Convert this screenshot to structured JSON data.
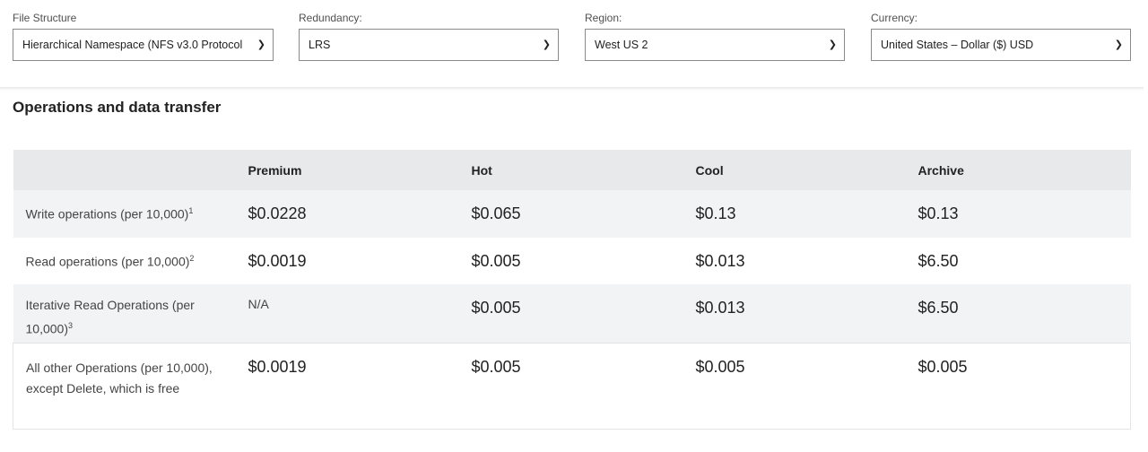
{
  "filters": [
    {
      "label": "File Structure",
      "value": "Hierarchical Namespace (NFS v3.0 Protocol"
    },
    {
      "label": "Redundancy:",
      "value": "LRS"
    },
    {
      "label": "Region:",
      "value": "West US 2"
    },
    {
      "label": "Currency:",
      "value": "United States – Dollar ($) USD"
    }
  ],
  "section_title": "Operations and data transfer",
  "table": {
    "columns": [
      "",
      "Premium",
      "Hot",
      "Cool",
      "Archive"
    ],
    "rows": [
      {
        "label": "Write operations (per 10,000)",
        "note": "1",
        "values": [
          "$0.0228",
          "$0.065",
          "$0.13",
          "$0.13"
        ]
      },
      {
        "label": "Read operations (per 10,000)",
        "note": "2",
        "values": [
          "$0.0019",
          "$0.005",
          "$0.013",
          "$6.50"
        ]
      },
      {
        "label": "Iterative Read Operations (per 10,000)",
        "note": "3",
        "values": [
          "N/A",
          "$0.005",
          "$0.013",
          "$6.50"
        ]
      },
      {
        "label": "All other Operations (per 10,000), except Delete, which is free",
        "note": "",
        "values": [
          "$0.0019",
          "$0.005",
          "$0.005",
          "$0.005"
        ]
      }
    ]
  }
}
